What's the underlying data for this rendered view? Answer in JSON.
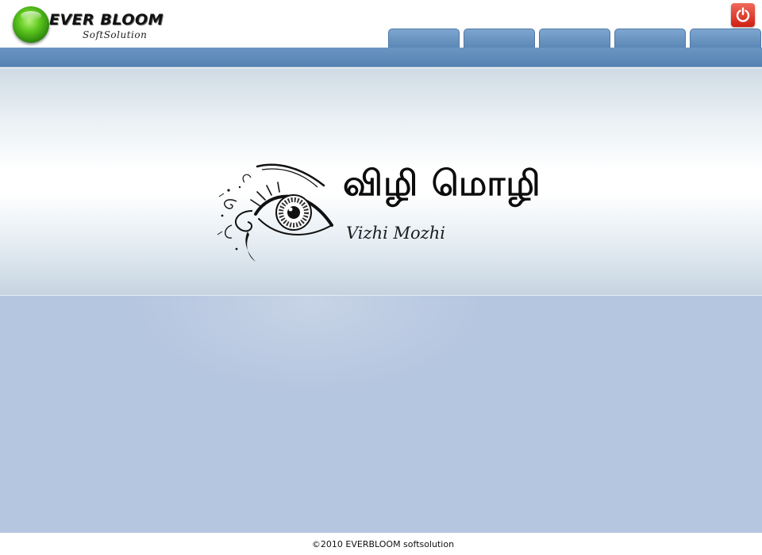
{
  "header": {
    "logo_name": "EVER BLOOM",
    "logo_sub": "SoftSolution",
    "power_icon": "power-icon",
    "tabs": [
      {
        "label": ""
      },
      {
        "label": ""
      },
      {
        "label": ""
      },
      {
        "label": ""
      },
      {
        "label": ""
      }
    ]
  },
  "banner": {
    "tamil_title": "விழி மொழி",
    "latin_title": "Vizhi Mozhi",
    "eye_icon": "eye-logo-icon"
  },
  "footer": {
    "copyright": "©2010 EVERBLOOM softsolution"
  },
  "colors": {
    "nav_bar": "#5f8cbb",
    "tab": "#6e98c4",
    "content_bg": "#b5c6e0",
    "power_button": "#e0382a"
  }
}
